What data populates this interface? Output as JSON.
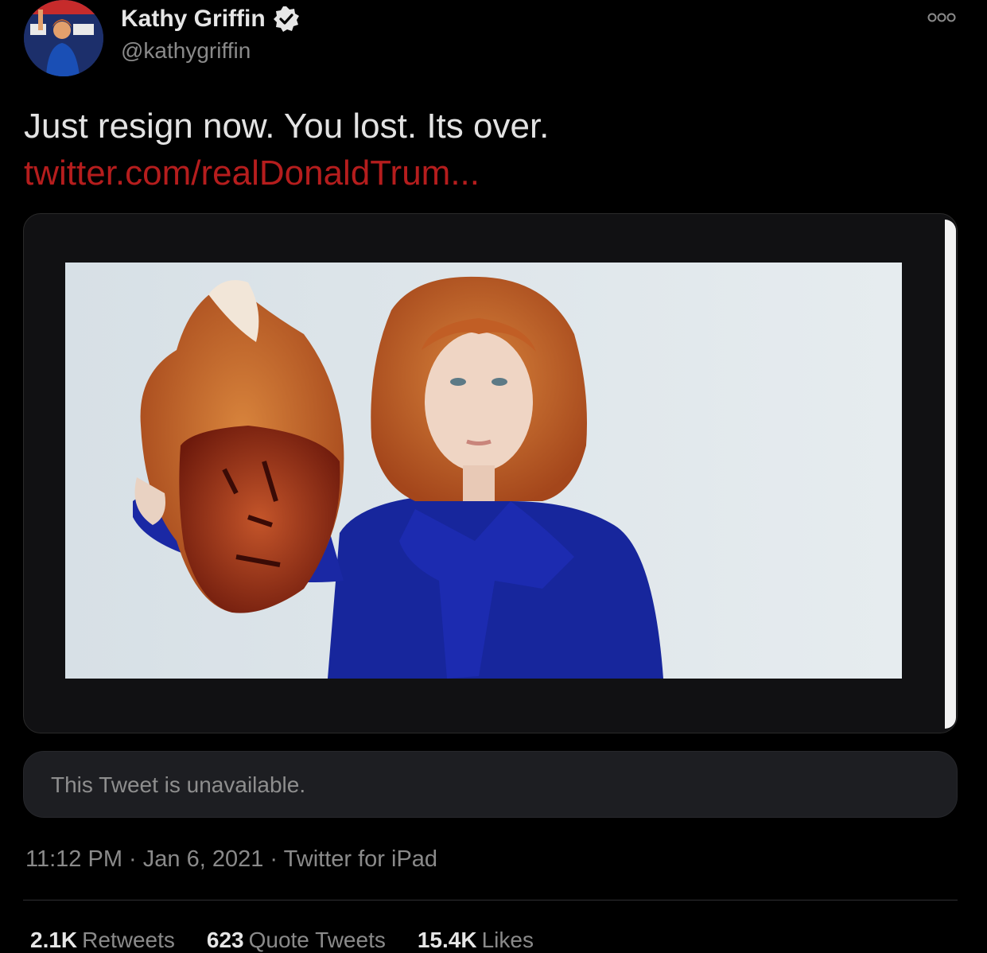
{
  "author": {
    "display_name": "Kathy Griffin",
    "handle": "@kathygriffin",
    "verified": true,
    "avatar_icon": "profile-photo"
  },
  "more_icon": "more-options-icon",
  "tweet": {
    "text": "Just resign now. You lost. Its over.",
    "link": "twitter.com/realDonaldTrum..."
  },
  "media": {
    "type": "photo"
  },
  "quoted_tweet": {
    "status_text": "This Tweet is unavailable."
  },
  "meta": {
    "time": "11:12 PM",
    "date": "Jan 6, 2021",
    "source": "Twitter for iPad",
    "separator": "·"
  },
  "stats": [
    {
      "value": "2.1K",
      "label": "Retweets"
    },
    {
      "value": "623",
      "label": "Quote Tweets"
    },
    {
      "value": "15.4K",
      "label": "Likes"
    }
  ],
  "colors": {
    "background": "#000000",
    "link": "#b51d1d",
    "muted": "#8a8a8a"
  }
}
